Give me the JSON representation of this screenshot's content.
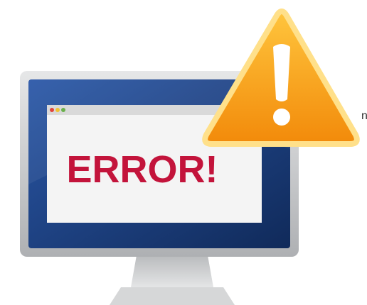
{
  "illustration": {
    "error_text": "ERROR!",
    "side_text": "n",
    "monitor_icon": "desktop-monitor-icon",
    "warning_icon": "warning-triangle-icon",
    "window_dots_icon": "window-controls-icon"
  },
  "colors": {
    "monitor_frame": "#c9cbcd",
    "screen_bezel": "#1f3f82",
    "window_bg": "#f4f4f4",
    "window_titlebar": "#d9d9d9",
    "error_text": "#c3143b",
    "warning_fill": "#f9a11b",
    "warning_stroke": "#ffe08a",
    "warning_mark": "#ffffff",
    "dot_red": "#e2453c",
    "dot_yellow": "#f1c232",
    "dot_green": "#6ab04c"
  }
}
